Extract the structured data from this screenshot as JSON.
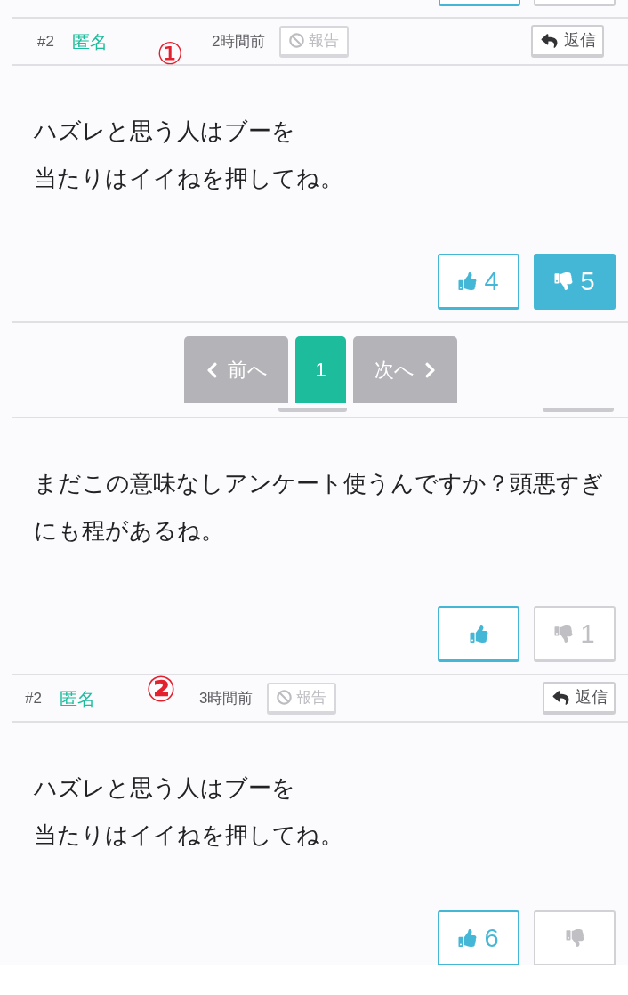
{
  "blocks": [
    {
      "kind": "vote_edges",
      "buttons": [
        {
          "kind": "like"
        },
        {
          "kind": "dislike"
        }
      ]
    },
    {
      "kind": "header",
      "number": "#2",
      "author": "匿名",
      "annotation": "①",
      "time": "2時間前",
      "report": {
        "label": "報告",
        "disabled": true
      },
      "reply": {
        "label": "返信"
      }
    },
    {
      "kind": "body",
      "lines": [
        "ハズレと思う人はブーを",
        "当たりはイイねを押してね。"
      ]
    },
    {
      "kind": "votes",
      "buttons": [
        {
          "kind": "like",
          "selected": false,
          "count": "4"
        },
        {
          "kind": "dislike",
          "selected": true,
          "count": "5"
        }
      ]
    },
    {
      "kind": "pagination",
      "items": [
        {
          "kind": "prev",
          "label": "前へ",
          "disabled": true
        },
        {
          "kind": "page",
          "label": "1",
          "selected": true
        },
        {
          "kind": "next",
          "label": "次へ",
          "disabled": true
        }
      ]
    },
    {
      "kind": "body",
      "lines": [
        "まだこの意味なしアンケート使うんですか？頭悪すぎにも程があるね。"
      ]
    },
    {
      "kind": "votes",
      "buttons": [
        {
          "kind": "like",
          "selected": false
        },
        {
          "kind": "dislike",
          "selected": false,
          "count": "1"
        }
      ]
    },
    {
      "kind": "header",
      "number": "#2",
      "author": "匿名",
      "annotation": "②",
      "time": "3時間前",
      "report": {
        "label": "報告",
        "disabled": true
      },
      "reply": {
        "label": "返信"
      }
    },
    {
      "kind": "body",
      "lines": [
        "ハズレと思う人はブーを",
        "当たりはイイねを押してね。"
      ]
    },
    {
      "kind": "votes",
      "buttons": [
        {
          "kind": "like",
          "selected": false,
          "count": "6"
        },
        {
          "kind": "dislike",
          "selected": false
        }
      ]
    }
  ]
}
